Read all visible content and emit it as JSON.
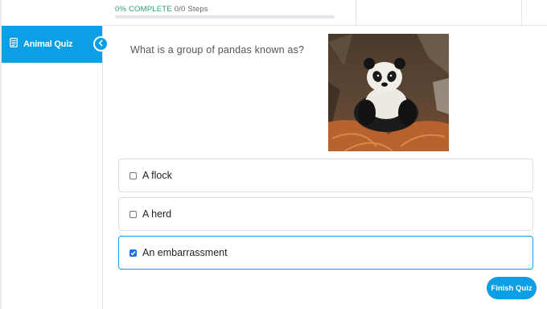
{
  "progress": {
    "percent_label": "0% COMPLETE",
    "steps_label": "0/0 Steps",
    "value": 0
  },
  "sidebar": {
    "course_title": "Animal Quiz"
  },
  "question": {
    "text": "What is a group of pandas known as?"
  },
  "answers": [
    {
      "label": "A flock",
      "checked": false
    },
    {
      "label": "A herd",
      "checked": false
    },
    {
      "label": "An embarrassment",
      "checked": true
    }
  ],
  "finish_button": {
    "label": "Finish Quiz"
  },
  "colors": {
    "accent": "#0d9fe6",
    "progress": "#2e9e6b",
    "checkbox": "#1a73e8"
  },
  "icons": {
    "course": "document-icon",
    "collapse": "chevron-left-icon",
    "check": "check-icon"
  }
}
